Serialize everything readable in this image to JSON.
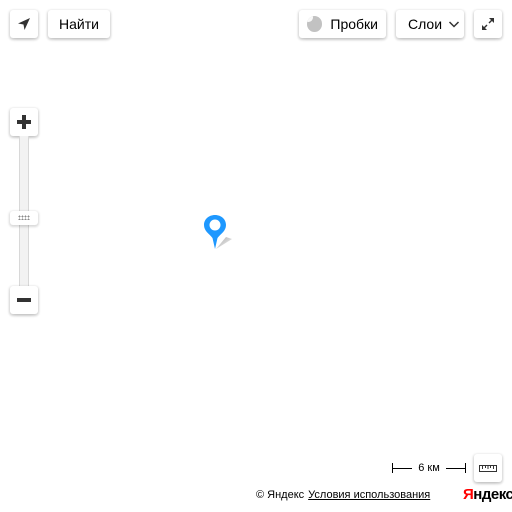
{
  "controls": {
    "find_label": "Найти",
    "traffic_label": "Пробки",
    "layers_label": "Слои",
    "icons": {
      "geolocation": "location-arrow-icon",
      "traffic": "traffic-light-icon",
      "layers_chevron": "chevron-down-icon",
      "fullscreen": "expand-icon",
      "zoom_in": "plus-icon",
      "zoom_out": "minus-icon",
      "ruler": "ruler-icon"
    }
  },
  "zoom": {
    "level_fraction": 0.45
  },
  "scale": {
    "label": "6 км"
  },
  "footer": {
    "copyright": "© Яндекс",
    "terms_label": "Условия использования",
    "logo_first": "Я",
    "logo_rest": "ндекс"
  },
  "colors": {
    "placemark": "#1e98ff",
    "logo_accent": "#ff0000"
  }
}
